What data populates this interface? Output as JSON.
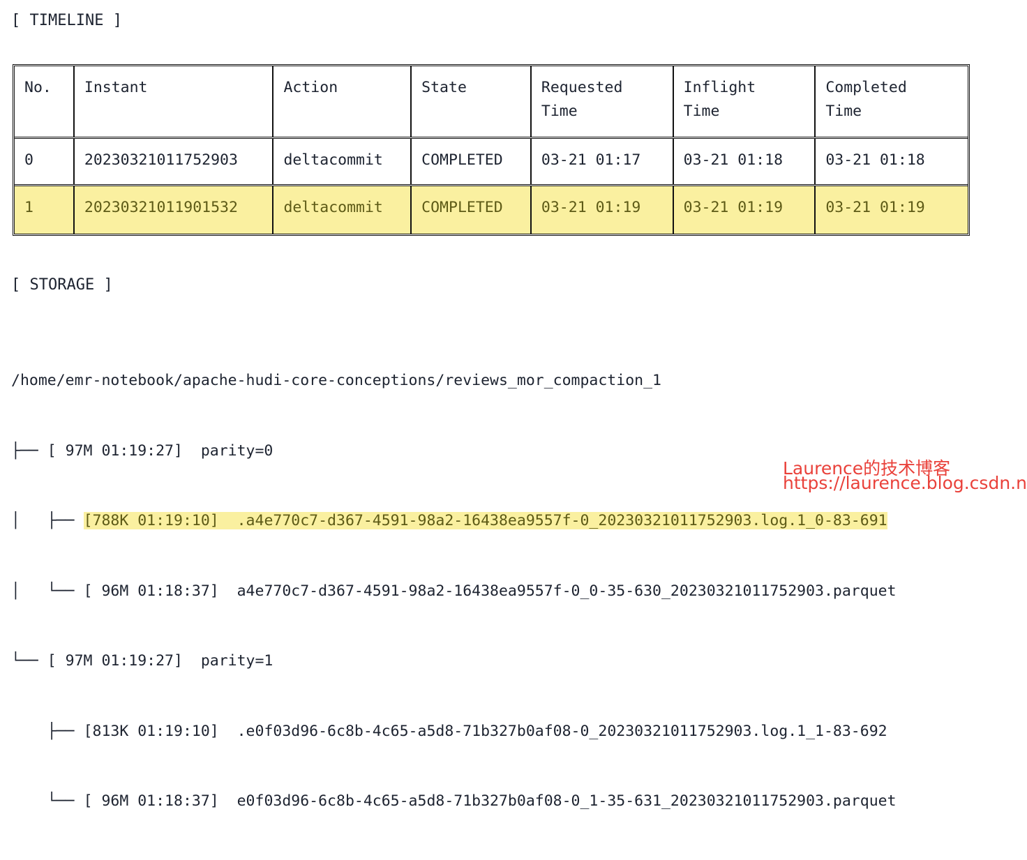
{
  "sections": {
    "timeline_header": "[ TIMELINE ]",
    "storage_header": "[ STORAGE ]"
  },
  "timeline": {
    "columns": [
      {
        "key": "no",
        "label": "No."
      },
      {
        "key": "instant",
        "label": "Instant"
      },
      {
        "key": "action",
        "label": "Action"
      },
      {
        "key": "state",
        "label": "State"
      },
      {
        "key": "requested_time",
        "label": "Requested\nTime"
      },
      {
        "key": "inflight_time",
        "label": "Inflight\nTime"
      },
      {
        "key": "completed_time",
        "label": "Completed\nTime"
      }
    ],
    "rows": [
      {
        "no": "0",
        "instant": "20230321011752903",
        "action": "deltacommit",
        "state": "COMPLETED",
        "requested_time": "03-21 01:17",
        "inflight_time": "03-21 01:18",
        "completed_time": "03-21 01:18",
        "highlighted": false
      },
      {
        "no": "1",
        "instant": "20230321011901532",
        "action": "deltacommit",
        "state": "COMPLETED",
        "requested_time": "03-21 01:19",
        "inflight_time": "03-21 01:19",
        "completed_time": "03-21 01:19",
        "highlighted": true
      }
    ]
  },
  "storage": {
    "root_path": "/home/emr-notebook/apache-hudi-core-conceptions/reviews_mor_compaction_1",
    "lines": [
      {
        "prefix": "├── [ 97M 01:19:27]  ",
        "text": "parity=0",
        "highlighted": false
      },
      {
        "prefix": "│   ├── ",
        "text": "[788K 01:19:10]  .a4e770c7-d367-4591-98a2-16438ea9557f-0_20230321011752903.log.1_0-83-691",
        "highlighted": true
      },
      {
        "prefix": "│   └── ",
        "text": "[ 96M 01:18:37]  a4e770c7-d367-4591-98a2-16438ea9557f-0_0-35-630_20230321011752903.parquet",
        "highlighted": false
      },
      {
        "prefix": "└── [ 97M 01:19:27]  ",
        "text": "parity=1",
        "highlighted": false
      },
      {
        "prefix": "    ├── ",
        "text": "[813K 01:19:10]  .e0f03d96-6c8b-4c65-a5d8-71b327b0af08-0_20230321011752903.log.1_1-83-692",
        "highlighted": false
      },
      {
        "prefix": "    └── ",
        "text": "[ 96M 01:18:37]  e0f03d96-6c8b-4c65-a5d8-71b327b0af08-0_1-35-631_20230321011752903.parquet",
        "highlighted": false
      }
    ]
  },
  "watermark": {
    "line1": "Laurence的技术博客",
    "line2": "https://laurence.blog.csdn.net",
    "color": "#e8312a"
  },
  "colors": {
    "highlight_bg": "#faf0a0",
    "highlight_fg": "#5d5a16",
    "text": "#1d2330",
    "border": "#111111",
    "background": "#ffffff"
  }
}
